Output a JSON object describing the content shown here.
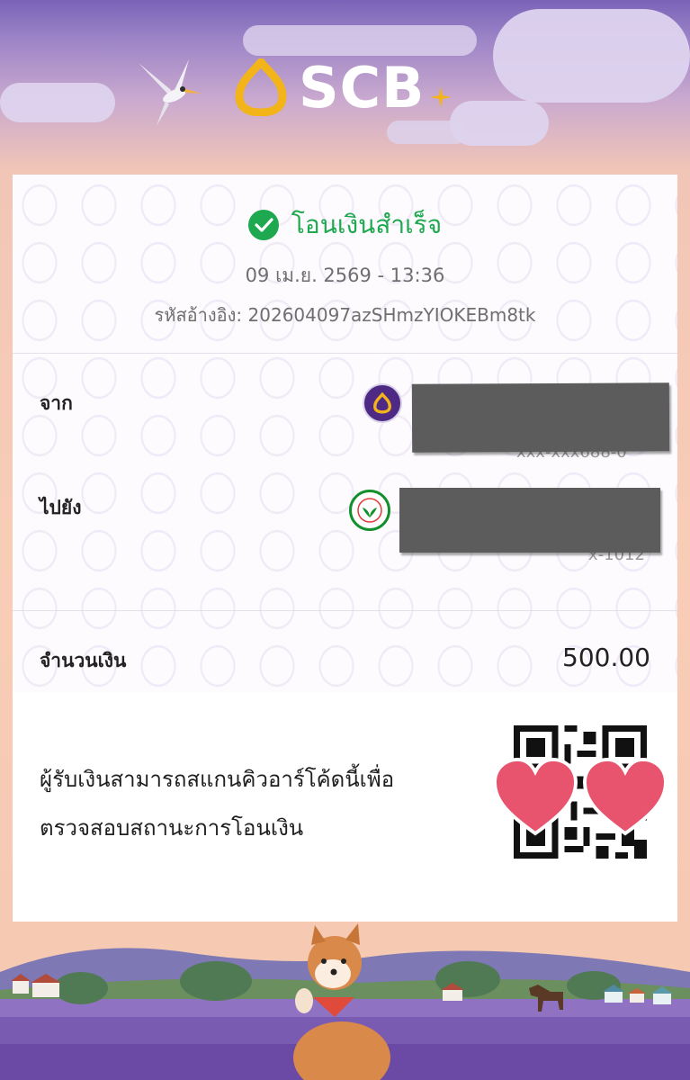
{
  "brand": {
    "name": "SCB"
  },
  "receipt": {
    "status": "โอนเงินสำเร็จ",
    "datetime": "09 เม.ย. 2569 - 13:36",
    "ref_label": "รหัสอ้างอิง:",
    "ref_value": "202604097azSHmzYIOKEBm8tk",
    "from_label": "จาก",
    "from_account_partial": "xxx-xxx688-0",
    "to_label": "ไปยัง",
    "to_account_partial": "x-1012",
    "amount_label": "จำนวนเงิน",
    "amount_value": "500.00",
    "qr_note_line1": "ผู้รับเงินสามารถสแกนคิวอาร์โค้ดนี้เพื่อ",
    "qr_note_line2": "ตรวจสอบสถานะการโอนเงิน"
  },
  "colors": {
    "success": "#1ea84f",
    "scb_purple": "#4e2a84",
    "scb_gold": "#f3b41a",
    "kbank_green": "#138f2d",
    "heart": "#e8546d"
  },
  "icons": [
    "check-circle-icon",
    "scb-logo-icon",
    "kbank-logo-icon",
    "qr-code",
    "heart-sticker-icon"
  ]
}
